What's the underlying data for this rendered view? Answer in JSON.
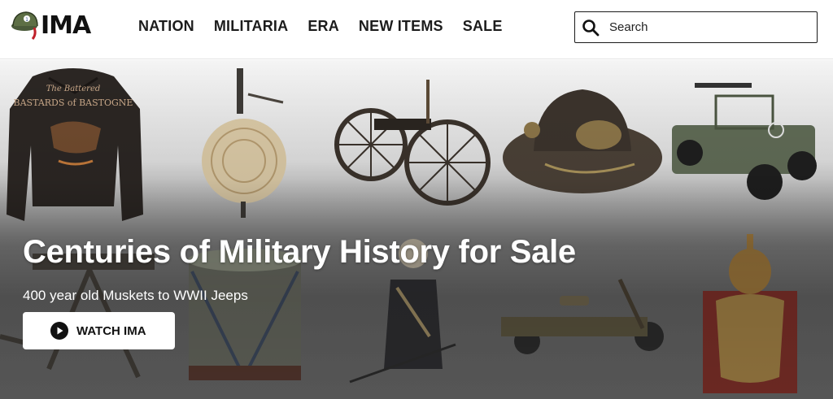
{
  "brand": {
    "logo_text": "IMA"
  },
  "nav": {
    "items": [
      {
        "label": "NATION"
      },
      {
        "label": "MILITARIA"
      },
      {
        "label": "ERA"
      },
      {
        "label": "NEW ITEMS"
      },
      {
        "label": "SALE"
      }
    ]
  },
  "search": {
    "placeholder": "Search",
    "value": ""
  },
  "hero": {
    "title": "Centuries of Military History for Sale",
    "subtitle": "400 year old Muskets to WWII Jeeps",
    "cta_label": "WATCH IMA",
    "jacket_text": "The Battered Bastards of Bastogne"
  },
  "colors": {
    "header_bg": "#ffffff",
    "text_dark": "#1c1c1c",
    "logo_accent": "#c0202a",
    "hero_text": "#ffffff"
  },
  "icons": [
    "helmet-logo-icon",
    "search-icon",
    "play-icon"
  ]
}
